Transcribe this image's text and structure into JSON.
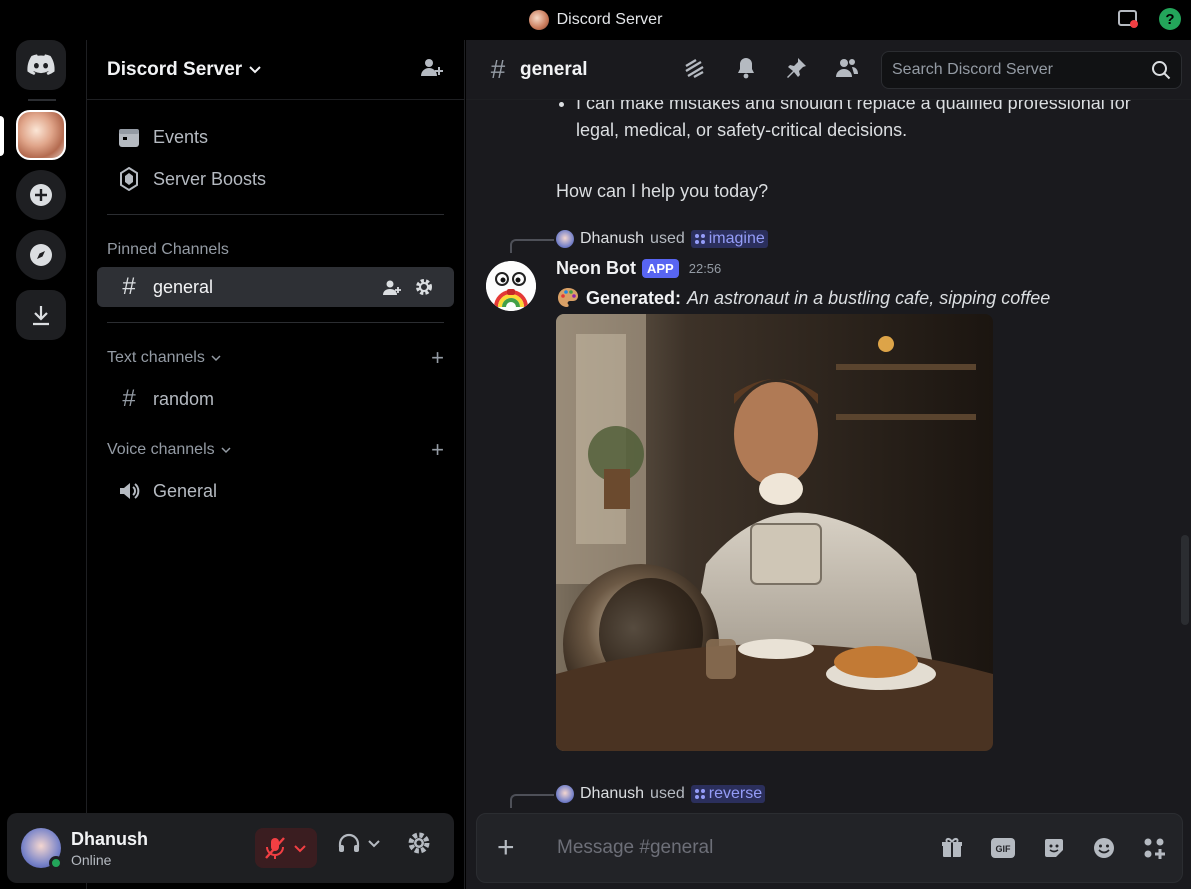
{
  "window": {
    "title": "Discord Server"
  },
  "sidebar": {
    "server_name": "Discord Server",
    "items": [
      {
        "label": "Events"
      },
      {
        "label": "Server Boosts"
      }
    ],
    "pinned_title": "Pinned Channels",
    "pinned_channel": "general",
    "text_category": "Text channels",
    "text_channels": [
      "random"
    ],
    "voice_category": "Voice channels",
    "voice_channels": [
      "General"
    ]
  },
  "user": {
    "name": "Dhanush",
    "status": "Online"
  },
  "header": {
    "channel": "general",
    "search_placeholder": "Search Discord Server"
  },
  "messages": {
    "prev_bullet": "I can make mistakes and shouldn't replace a qualified professional for legal, medical, or safety-critical decisions.",
    "prev_question": "How can I help you today?",
    "reply1": {
      "user": "Dhanush",
      "used": "used",
      "command": "imagine"
    },
    "bot": {
      "name": "Neon Bot",
      "badge": "APP",
      "time": "22:56"
    },
    "generated_label": "Generated:",
    "generated_prompt": "An astronaut in a bustling cafe, sipping coffee",
    "reply2": {
      "user": "Dhanush",
      "used": "used",
      "command": "reverse"
    }
  },
  "composer": {
    "placeholder": "Message #general"
  },
  "colors": {
    "accent": "#5865f2",
    "online": "#23a55a",
    "command": "#949cf7"
  }
}
